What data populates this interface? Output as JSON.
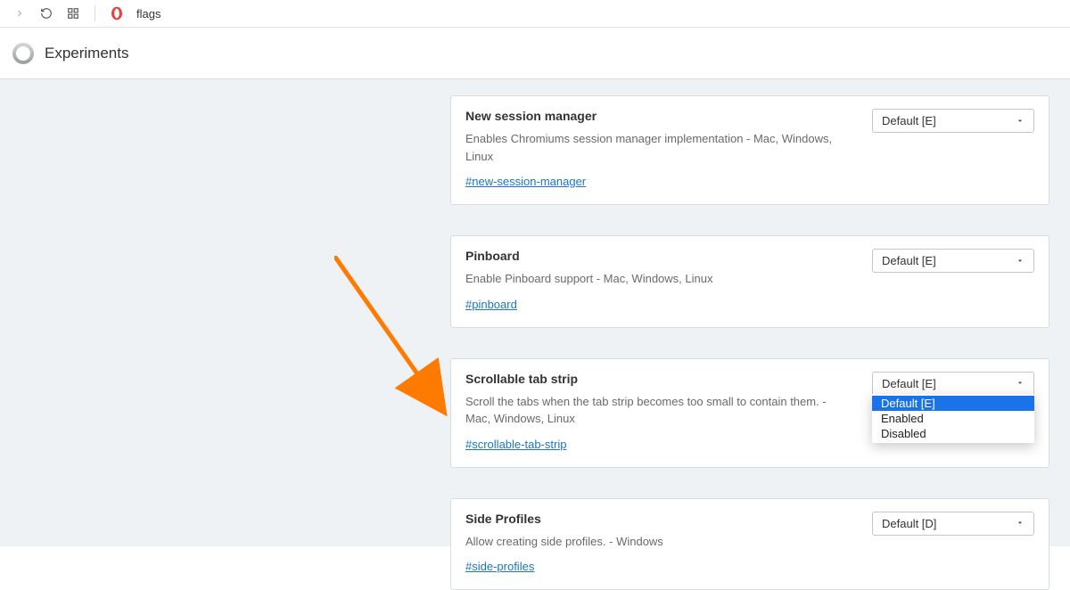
{
  "toolbar": {
    "url": "flags"
  },
  "header": {
    "title": "Experiments"
  },
  "cards": [
    {
      "title": "New session manager",
      "desc": "Enables Chromiums session manager implementation - Mac, Windows, Linux",
      "hash": "#new-session-manager",
      "select": "Default [E]"
    },
    {
      "title": "Pinboard",
      "desc": "Enable Pinboard support - Mac, Windows, Linux",
      "hash": "#pinboard",
      "select": "Default [E]"
    },
    {
      "title": "Scrollable tab strip",
      "desc": "Scroll the tabs when the tab strip becomes too small to contain them. - Mac, Windows, Linux",
      "hash": "#scrollable-tab-strip",
      "select": "Default [E]",
      "dropdown": {
        "0": "Default [E]",
        "1": "Enabled",
        "2": "Disabled"
      }
    },
    {
      "title": "Side Profiles",
      "desc": "Allow creating side profiles. - Windows",
      "hash": "#side-profiles",
      "select": "Default [D]"
    }
  ]
}
